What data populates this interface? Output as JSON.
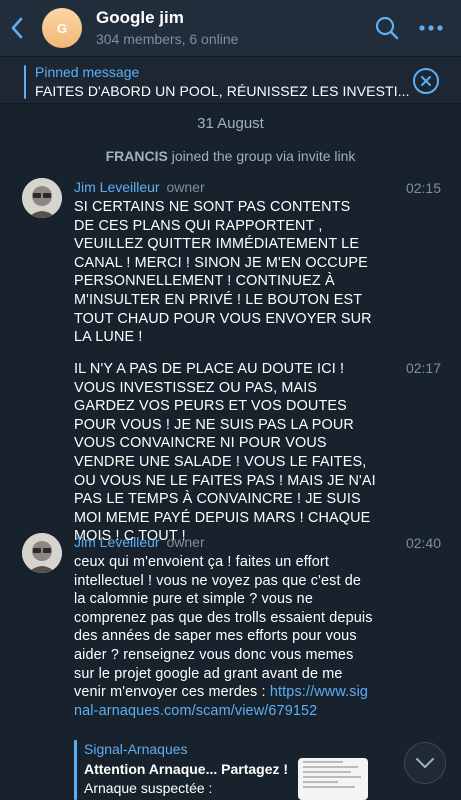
{
  "header": {
    "avatar_letter": "G",
    "title": "Google jim",
    "subtitle": "304 members, 6 online",
    "back_icon": "chevron-left-icon",
    "search_icon": "search-icon",
    "more_icon": "more-icon"
  },
  "pinned": {
    "label": "Pinned message",
    "text": "FAITES D'ABORD UN POOL, RÉUNISSEZ LES INVESTI..."
  },
  "date_separator": "31 August",
  "service_message": {
    "name": "FRANCIS",
    "text": " joined the group via invite link"
  },
  "messages": [
    {
      "sender": "Jim Leveilleur",
      "role": "owner",
      "time": "02:15",
      "text": "SI CERTAINS NE SONT PAS CONTENTS DE CES PLANS QUI RAPPORTENT , VEUILLEZ QUITTER IMMÉDIATEMENT LE CANAL ! MERCI ! SINON JE M'EN OCCUPE PERSONNELLEMENT ! CONTINUEZ À M'INSULTER EN PRIVÉ ! LE BOUTON EST TOUT CHAUD POUR VOUS ENVOYER SUR LA LUNE !"
    },
    {
      "time": "02:17",
      "text": "IL N'Y A PAS DE PLACE AU DOUTE ICI ! VOUS INVESTISSEZ OU PAS, MAIS GARDEZ VOS PEURS ET VOS DOUTES POUR VOUS ! JE NE SUIS PAS LA POUR VOUS CONVAINCRE NI POUR VOUS VENDRE UNE SALADE ! VOUS LE FAITES, OU VOUS NE LE FAITES PAS ! MAIS JE N'AI PAS LE TEMPS À CONVAINCRE ! JE SUIS MOI MEME PAYÉ DEPUIS MARS ! CHAQUE MOIS ! C TOUT !"
    },
    {
      "sender": "Jim Leveilleur",
      "role": "owner",
      "time": "02:40",
      "text": "ceux qui m'envoient ça ! faites un effort intellectuel ! vous ne voyez pas que c'est de la calomnie pure et simple ? vous ne comprenez pas que des trolls essaient depuis des années de saper mes efforts pour vous aider ? renseignez vous donc vous memes sur le projet google ad grant avant de me venir m'envoyer ces merdes :",
      "link": "https://www.signal-arnaques.com/scam/view/679152",
      "preview": {
        "site": "Signal-Arnaques",
        "title": "Attention Arnaque... Partagez !",
        "desc": "Arnaque suspectée :"
      }
    }
  ],
  "scroll_icon": "chevron-down-icon",
  "colors": {
    "accent": "#5eaef2",
    "background": "#18222d",
    "header": "#212d3b"
  }
}
